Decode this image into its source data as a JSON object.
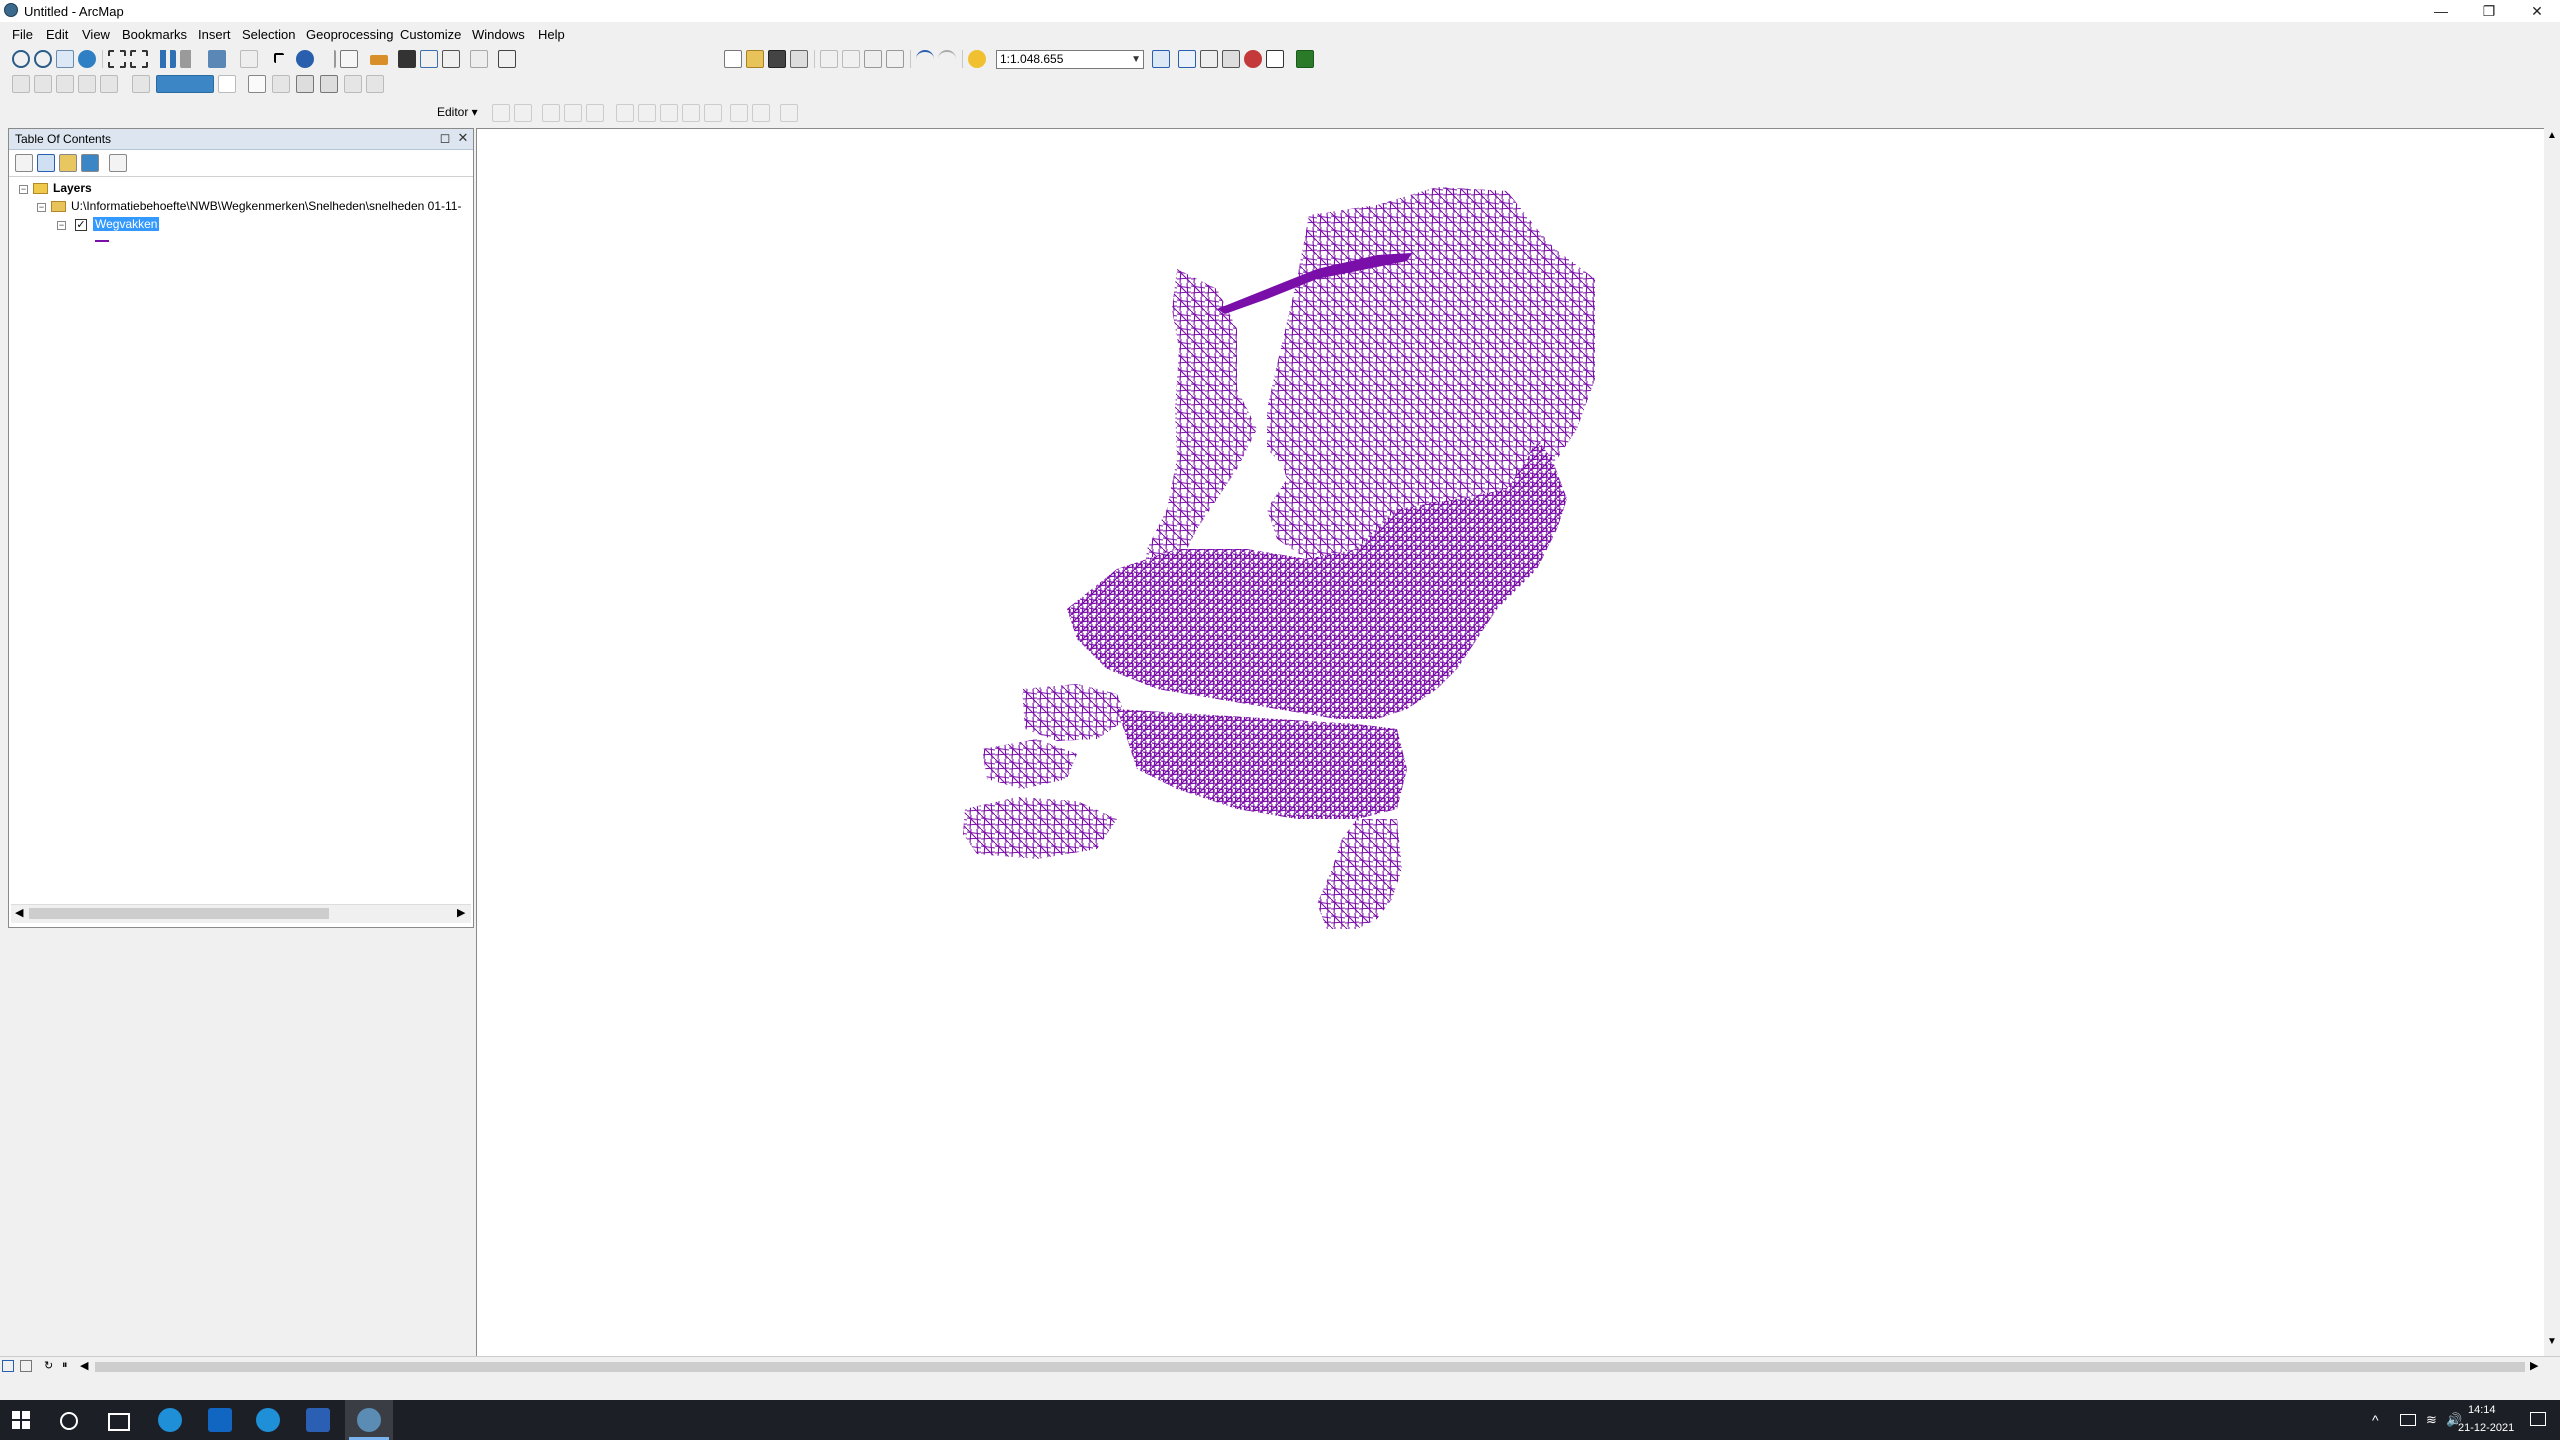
{
  "window": {
    "title": "Untitled - ArcMap",
    "controls": [
      "—",
      "❐",
      "✕"
    ]
  },
  "menu": {
    "items": [
      "File",
      "Edit",
      "View",
      "Bookmarks",
      "Insert",
      "Selection",
      "Geoprocessing",
      "Customize",
      "Windows",
      "Help"
    ]
  },
  "toolbar": {
    "scale_value": "1:1.048.655",
    "editor_label": "Editor ▾"
  },
  "toc": {
    "title": "Table Of Contents",
    "root_label": "Layers",
    "path_label": "U:\\Informatiebehoefte\\NWB\\Wegkenmerken\\Snelheden\\snelheden 01-11-",
    "layer_label": "Wegvakken",
    "layer_checked": "✓",
    "expand_minus": "−"
  },
  "map": {
    "layer_color": "#7a0ea8",
    "description_hidden": true
  },
  "taskbar": {
    "time": "14:14",
    "date": "21-12-2021"
  }
}
